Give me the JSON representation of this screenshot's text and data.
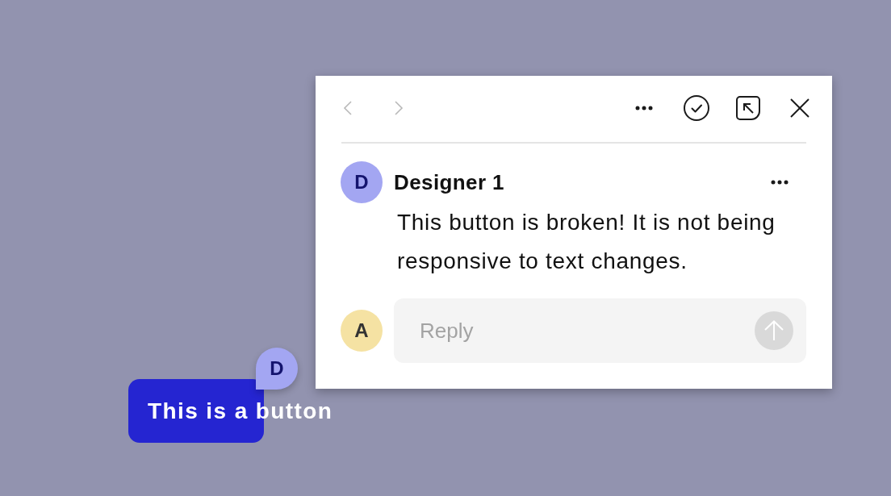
{
  "canvas": {
    "button": {
      "label": "This is a button"
    },
    "comment_pin": {
      "initial": "D"
    }
  },
  "comment_panel": {
    "toolbar": {
      "nav": [
        {
          "kind": "previous",
          "disabled": true
        },
        {
          "kind": "next",
          "disabled": true
        }
      ]
    },
    "comment": {
      "initial": "D",
      "author": "Designer 1",
      "text": "This button is broken! It is not being responsive to text changes."
    },
    "reply": {
      "initial": "A",
      "placeholder": "Reply",
      "send_button": {
        "disabled": true
      }
    }
  }
}
